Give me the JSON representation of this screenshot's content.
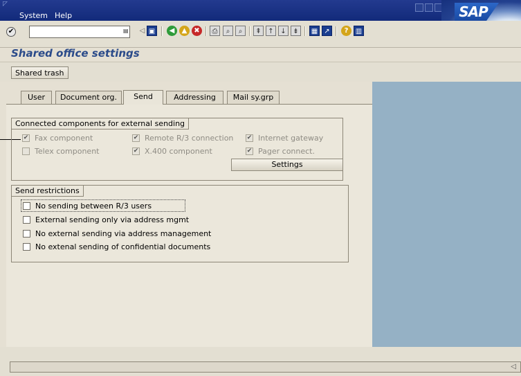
{
  "menu": {
    "system": "System",
    "help": "Help"
  },
  "page_title": "Shared office settings",
  "appbar": {
    "shared_trash": "Shared trash"
  },
  "tabs": [
    {
      "label": "User",
      "active": false
    },
    {
      "label": "Document org.",
      "active": false
    },
    {
      "label": "Send",
      "active": true
    },
    {
      "label": "Addressing",
      "active": false
    },
    {
      "label": "Mail sy.grp",
      "active": false
    }
  ],
  "connected": {
    "title": "Connected components for external sending",
    "items": [
      {
        "label": "Fax component",
        "checked": true
      },
      {
        "label": "Remote R/3 connection",
        "checked": true
      },
      {
        "label": "Internet gateway",
        "checked": true
      },
      {
        "label": "Telex component",
        "checked": false
      },
      {
        "label": "X.400 component",
        "checked": true
      },
      {
        "label": "Pager connect.",
        "checked": true
      }
    ],
    "settings_button": "Settings"
  },
  "restrictions": {
    "title": "Send restrictions",
    "items": [
      {
        "label": "No sending between R/3 users",
        "checked": false
      },
      {
        "label": "External sending only via address mgmt",
        "checked": false
      },
      {
        "label": "No external sending via address management",
        "checked": false
      },
      {
        "label": "No extenal sending of confidential documents",
        "checked": false
      }
    ]
  },
  "logo": "SAP",
  "colors": {
    "title_blue": "#2b4b8a",
    "menubar": "#1a3285",
    "right_panel": "#95b1c5"
  },
  "icons": [
    "ok-icon",
    "back-icon",
    "save-icon",
    "back-nav-icon",
    "exit-icon",
    "cancel-icon",
    "print-icon",
    "find-icon",
    "find-next-icon",
    "first-page-icon",
    "prev-page-icon",
    "next-page-icon",
    "last-page-icon",
    "new-session-icon",
    "shortcut-icon",
    "help-icon",
    "layout-icon"
  ]
}
